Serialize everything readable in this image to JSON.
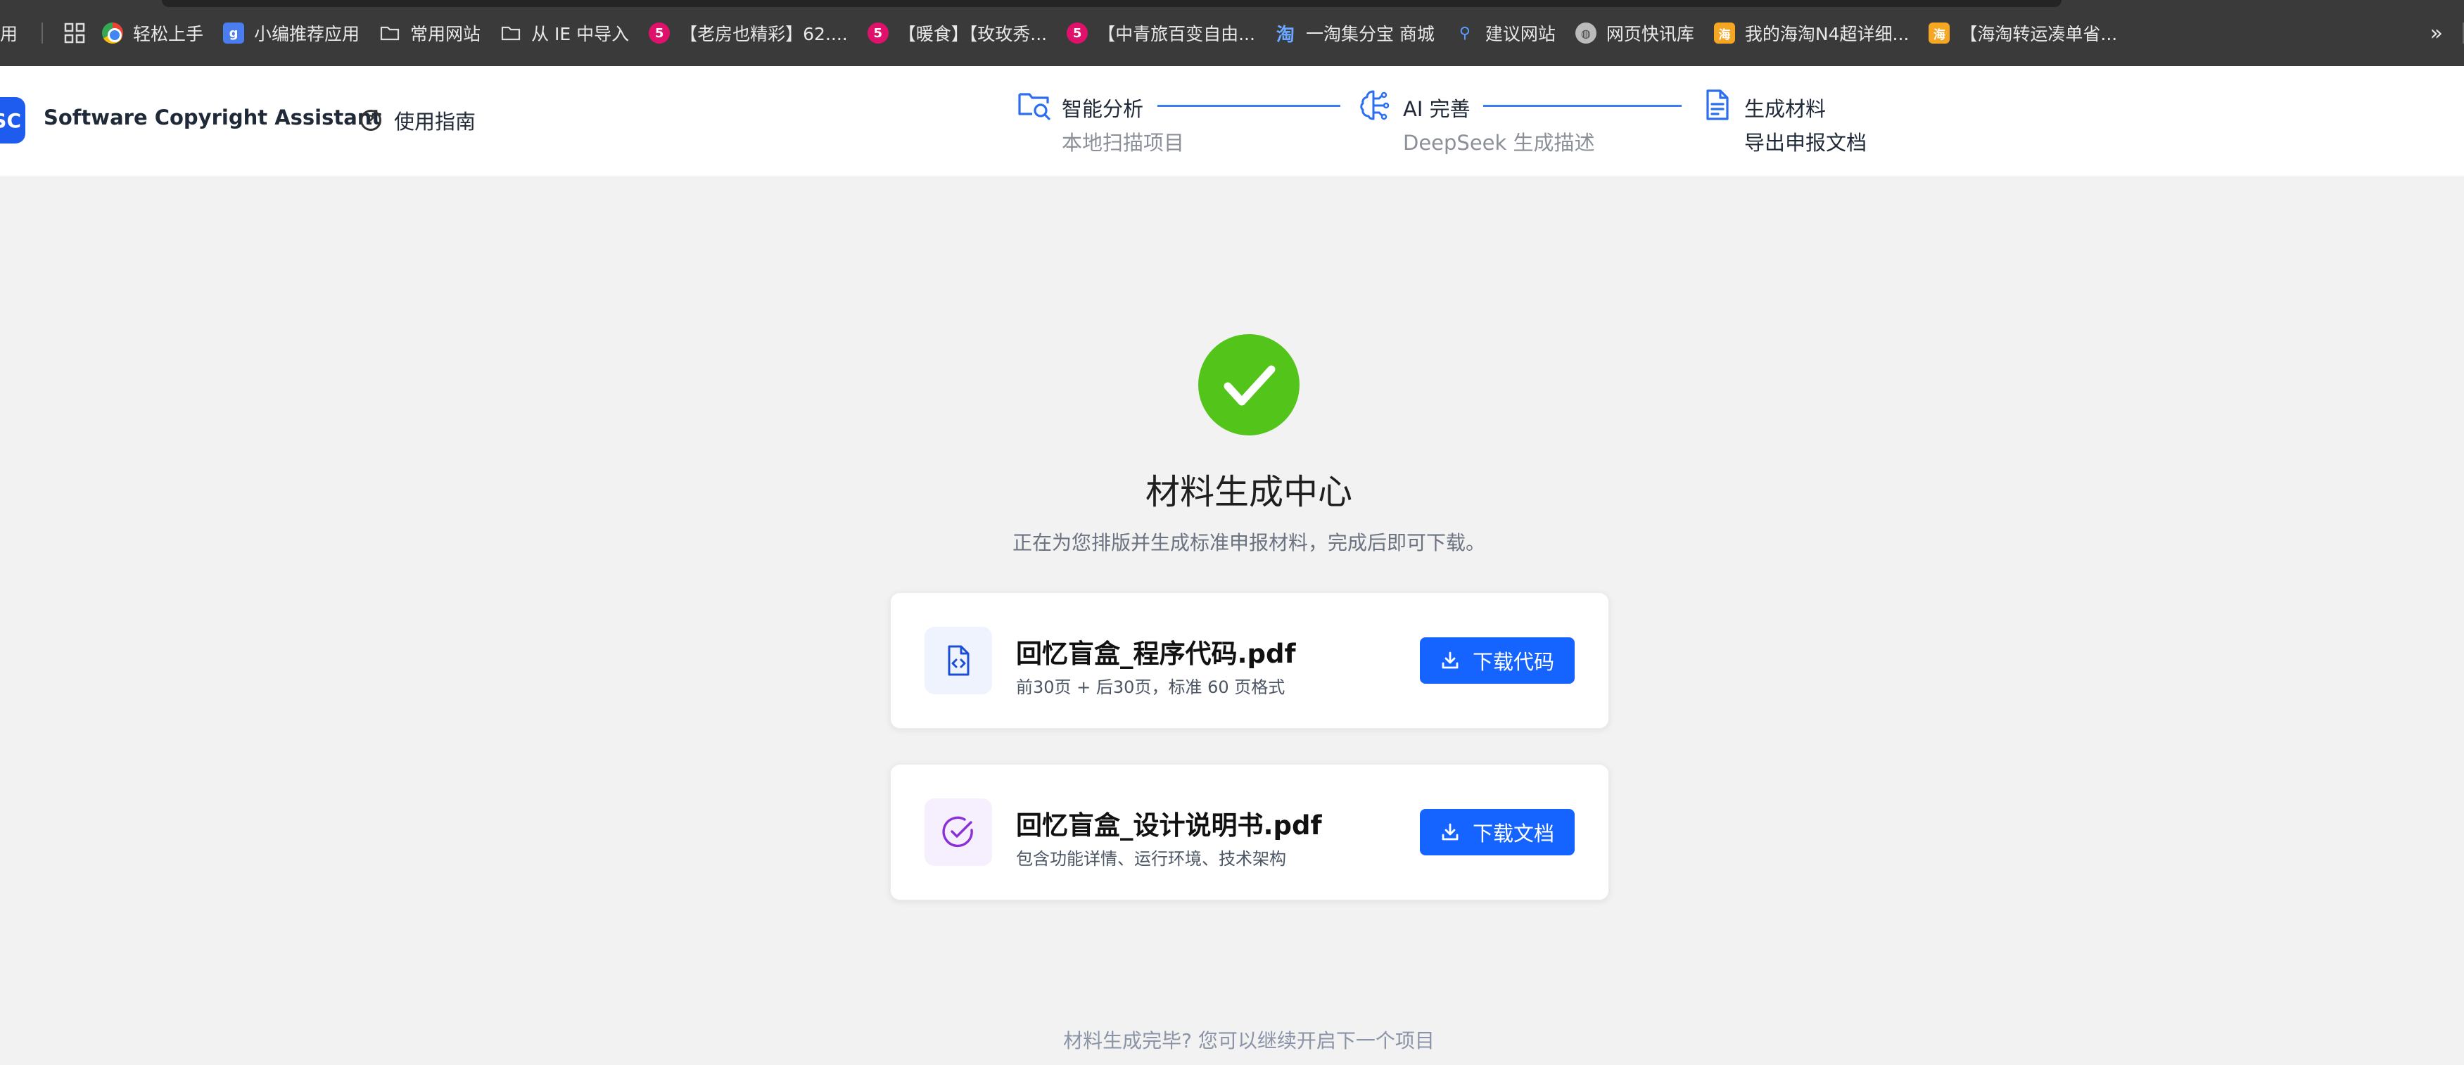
{
  "bookmarks": {
    "first_fragment": "用",
    "items": [
      {
        "icon": "chrome-icon",
        "label": "轻松上手"
      },
      {
        "icon": "g-app-icon",
        "label": "小编推荐应用"
      },
      {
        "icon": "folder-icon",
        "label": "常用网站"
      },
      {
        "icon": "folder-icon",
        "label": "从 IE 中导入"
      },
      {
        "icon": "five-icon",
        "label": "【老房也精彩】62...."
      },
      {
        "icon": "five-icon",
        "label": "【暖食】【玫玫秀..."
      },
      {
        "icon": "five-icon",
        "label": "【中青旅百变自由..."
      },
      {
        "icon": "taobao-icon",
        "label": "一淘集分宝 商城"
      },
      {
        "icon": "search-icon",
        "label": "建议网站"
      },
      {
        "icon": "globe-icon",
        "label": "网页快讯库"
      },
      {
        "icon": "haitao-icon",
        "label": "我的海淘N4超详细..."
      },
      {
        "icon": "haitao-icon",
        "label": "【海淘转运凑单省..."
      }
    ],
    "overflow": "»"
  },
  "header": {
    "logo_text": "SC",
    "app_name": "Software Copyright Assistant",
    "guide_label": "使用指南",
    "steps": [
      {
        "title": "智能分析",
        "subtitle": "本地扫描项目"
      },
      {
        "title": "AI 完善",
        "subtitle": "DeepSeek 生成描述"
      },
      {
        "title": "生成材料",
        "subtitle": "导出申报文档"
      }
    ]
  },
  "main": {
    "title": "材料生成中心",
    "subtitle": "正在为您排版并生成标准申报材料，完成后即可下载。",
    "files": [
      {
        "name": "回忆盲盒_程序代码.pdf",
        "desc": "前30页 + 后30页，标准 60 页格式",
        "button": "下载代码"
      },
      {
        "name": "回忆盲盒_设计说明书.pdf",
        "desc": "包含功能详情、运行环境、技术架构",
        "button": "下载文档"
      }
    ],
    "footer_note": "材料生成完毕? 您可以继续开启下一个项目"
  },
  "colors": {
    "primary": "#1664ff",
    "success": "#52c41a",
    "purple": "#8b2fd9",
    "bookmarks_bg": "#3a3a3a"
  }
}
